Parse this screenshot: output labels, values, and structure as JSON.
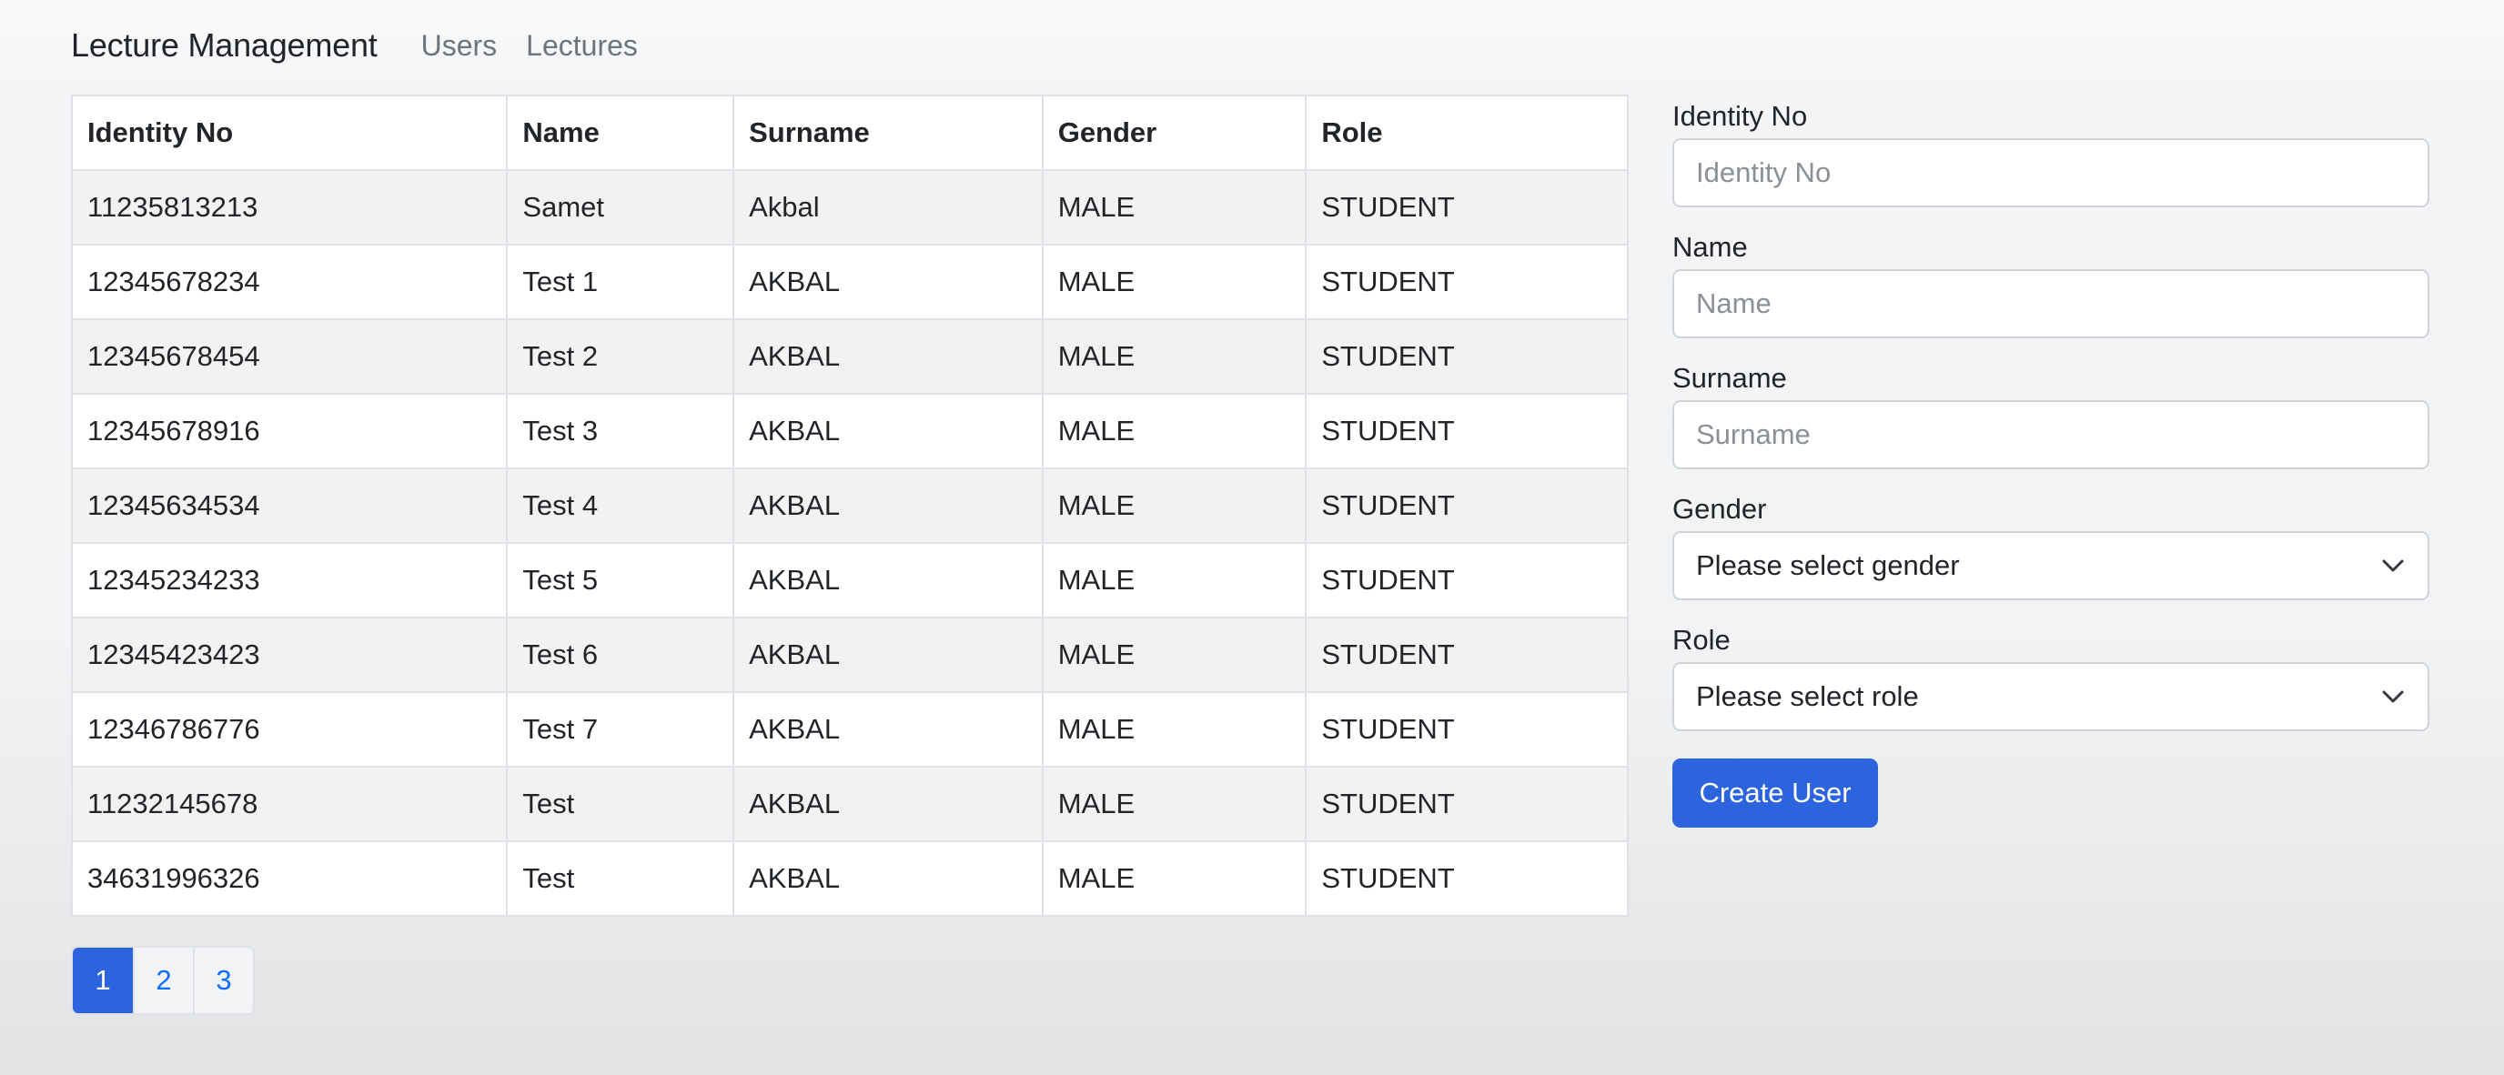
{
  "navbar": {
    "brand": "Lecture Management",
    "links": [
      "Users",
      "Lectures"
    ]
  },
  "table": {
    "headers": [
      "Identity No",
      "Name",
      "Surname",
      "Gender",
      "Role"
    ],
    "rows": [
      [
        "11235813213",
        "Samet",
        "Akbal",
        "MALE",
        "STUDENT"
      ],
      [
        "12345678234",
        "Test 1",
        "AKBAL",
        "MALE",
        "STUDENT"
      ],
      [
        "12345678454",
        "Test 2",
        "AKBAL",
        "MALE",
        "STUDENT"
      ],
      [
        "12345678916",
        "Test 3",
        "AKBAL",
        "MALE",
        "STUDENT"
      ],
      [
        "12345634534",
        "Test 4",
        "AKBAL",
        "MALE",
        "STUDENT"
      ],
      [
        "12345234233",
        "Test 5",
        "AKBAL",
        "MALE",
        "STUDENT"
      ],
      [
        "12345423423",
        "Test 6",
        "AKBAL",
        "MALE",
        "STUDENT"
      ],
      [
        "12346786776",
        "Test 7",
        "AKBAL",
        "MALE",
        "STUDENT"
      ],
      [
        "11232145678",
        "Test",
        "AKBAL",
        "MALE",
        "STUDENT"
      ],
      [
        "34631996326",
        "Test",
        "AKBAL",
        "MALE",
        "STUDENT"
      ]
    ]
  },
  "pagination": {
    "pages": [
      "1",
      "2",
      "3"
    ],
    "active": "1"
  },
  "form": {
    "identity_label": "Identity No",
    "identity_placeholder": "Identity No",
    "identity_value": "",
    "name_label": "Name",
    "name_placeholder": "Name",
    "name_value": "",
    "surname_label": "Surname",
    "surname_placeholder": "Surname",
    "surname_value": "",
    "gender_label": "Gender",
    "gender_selected": "Please select gender",
    "role_label": "Role",
    "role_selected": "Please select role",
    "submit_label": "Create User"
  },
  "colors": {
    "primary": "#2b64dd",
    "link": "#0d6efd",
    "striped_row": "#f2f2f2",
    "border": "#dee2e6"
  },
  "icons": {
    "select_chevron": "chevron-down-icon"
  }
}
